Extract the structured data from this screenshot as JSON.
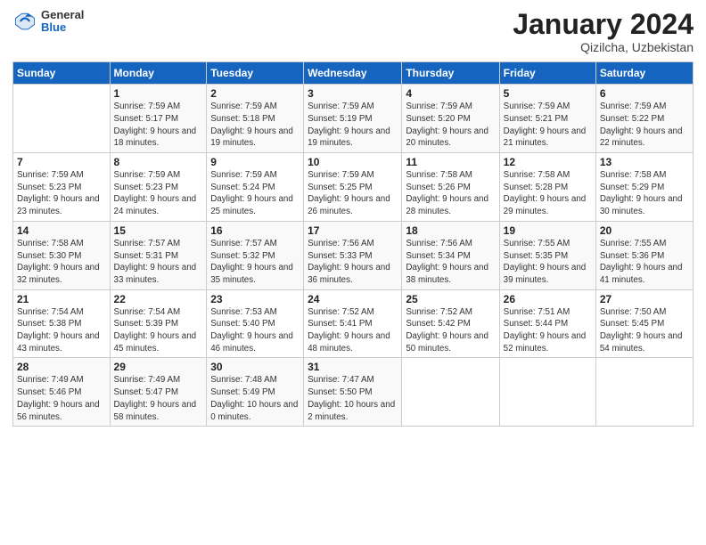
{
  "header": {
    "logo_general": "General",
    "logo_blue": "Blue",
    "month": "January 2024",
    "location": "Qizilcha, Uzbekistan"
  },
  "days_of_week": [
    "Sunday",
    "Monday",
    "Tuesday",
    "Wednesday",
    "Thursday",
    "Friday",
    "Saturday"
  ],
  "weeks": [
    [
      null,
      {
        "day": 1,
        "sunrise": "7:59 AM",
        "sunset": "5:17 PM",
        "daylight": "9 hours and 18 minutes."
      },
      {
        "day": 2,
        "sunrise": "7:59 AM",
        "sunset": "5:18 PM",
        "daylight": "9 hours and 19 minutes."
      },
      {
        "day": 3,
        "sunrise": "7:59 AM",
        "sunset": "5:19 PM",
        "daylight": "9 hours and 19 minutes."
      },
      {
        "day": 4,
        "sunrise": "7:59 AM",
        "sunset": "5:20 PM",
        "daylight": "9 hours and 20 minutes."
      },
      {
        "day": 5,
        "sunrise": "7:59 AM",
        "sunset": "5:21 PM",
        "daylight": "9 hours and 21 minutes."
      },
      {
        "day": 6,
        "sunrise": "7:59 AM",
        "sunset": "5:22 PM",
        "daylight": "9 hours and 22 minutes."
      }
    ],
    [
      {
        "day": 7,
        "sunrise": "7:59 AM",
        "sunset": "5:23 PM",
        "daylight": "9 hours and 23 minutes."
      },
      {
        "day": 8,
        "sunrise": "7:59 AM",
        "sunset": "5:23 PM",
        "daylight": "9 hours and 24 minutes."
      },
      {
        "day": 9,
        "sunrise": "7:59 AM",
        "sunset": "5:24 PM",
        "daylight": "9 hours and 25 minutes."
      },
      {
        "day": 10,
        "sunrise": "7:59 AM",
        "sunset": "5:25 PM",
        "daylight": "9 hours and 26 minutes."
      },
      {
        "day": 11,
        "sunrise": "7:58 AM",
        "sunset": "5:26 PM",
        "daylight": "9 hours and 28 minutes."
      },
      {
        "day": 12,
        "sunrise": "7:58 AM",
        "sunset": "5:28 PM",
        "daylight": "9 hours and 29 minutes."
      },
      {
        "day": 13,
        "sunrise": "7:58 AM",
        "sunset": "5:29 PM",
        "daylight": "9 hours and 30 minutes."
      }
    ],
    [
      {
        "day": 14,
        "sunrise": "7:58 AM",
        "sunset": "5:30 PM",
        "daylight": "9 hours and 32 minutes."
      },
      {
        "day": 15,
        "sunrise": "7:57 AM",
        "sunset": "5:31 PM",
        "daylight": "9 hours and 33 minutes."
      },
      {
        "day": 16,
        "sunrise": "7:57 AM",
        "sunset": "5:32 PM",
        "daylight": "9 hours and 35 minutes."
      },
      {
        "day": 17,
        "sunrise": "7:56 AM",
        "sunset": "5:33 PM",
        "daylight": "9 hours and 36 minutes."
      },
      {
        "day": 18,
        "sunrise": "7:56 AM",
        "sunset": "5:34 PM",
        "daylight": "9 hours and 38 minutes."
      },
      {
        "day": 19,
        "sunrise": "7:55 AM",
        "sunset": "5:35 PM",
        "daylight": "9 hours and 39 minutes."
      },
      {
        "day": 20,
        "sunrise": "7:55 AM",
        "sunset": "5:36 PM",
        "daylight": "9 hours and 41 minutes."
      }
    ],
    [
      {
        "day": 21,
        "sunrise": "7:54 AM",
        "sunset": "5:38 PM",
        "daylight": "9 hours and 43 minutes."
      },
      {
        "day": 22,
        "sunrise": "7:54 AM",
        "sunset": "5:39 PM",
        "daylight": "9 hours and 45 minutes."
      },
      {
        "day": 23,
        "sunrise": "7:53 AM",
        "sunset": "5:40 PM",
        "daylight": "9 hours and 46 minutes."
      },
      {
        "day": 24,
        "sunrise": "7:52 AM",
        "sunset": "5:41 PM",
        "daylight": "9 hours and 48 minutes."
      },
      {
        "day": 25,
        "sunrise": "7:52 AM",
        "sunset": "5:42 PM",
        "daylight": "9 hours and 50 minutes."
      },
      {
        "day": 26,
        "sunrise": "7:51 AM",
        "sunset": "5:44 PM",
        "daylight": "9 hours and 52 minutes."
      },
      {
        "day": 27,
        "sunrise": "7:50 AM",
        "sunset": "5:45 PM",
        "daylight": "9 hours and 54 minutes."
      }
    ],
    [
      {
        "day": 28,
        "sunrise": "7:49 AM",
        "sunset": "5:46 PM",
        "daylight": "9 hours and 56 minutes."
      },
      {
        "day": 29,
        "sunrise": "7:49 AM",
        "sunset": "5:47 PM",
        "daylight": "9 hours and 58 minutes."
      },
      {
        "day": 30,
        "sunrise": "7:48 AM",
        "sunset": "5:49 PM",
        "daylight": "10 hours and 0 minutes."
      },
      {
        "day": 31,
        "sunrise": "7:47 AM",
        "sunset": "5:50 PM",
        "daylight": "10 hours and 2 minutes."
      },
      null,
      null,
      null
    ]
  ]
}
